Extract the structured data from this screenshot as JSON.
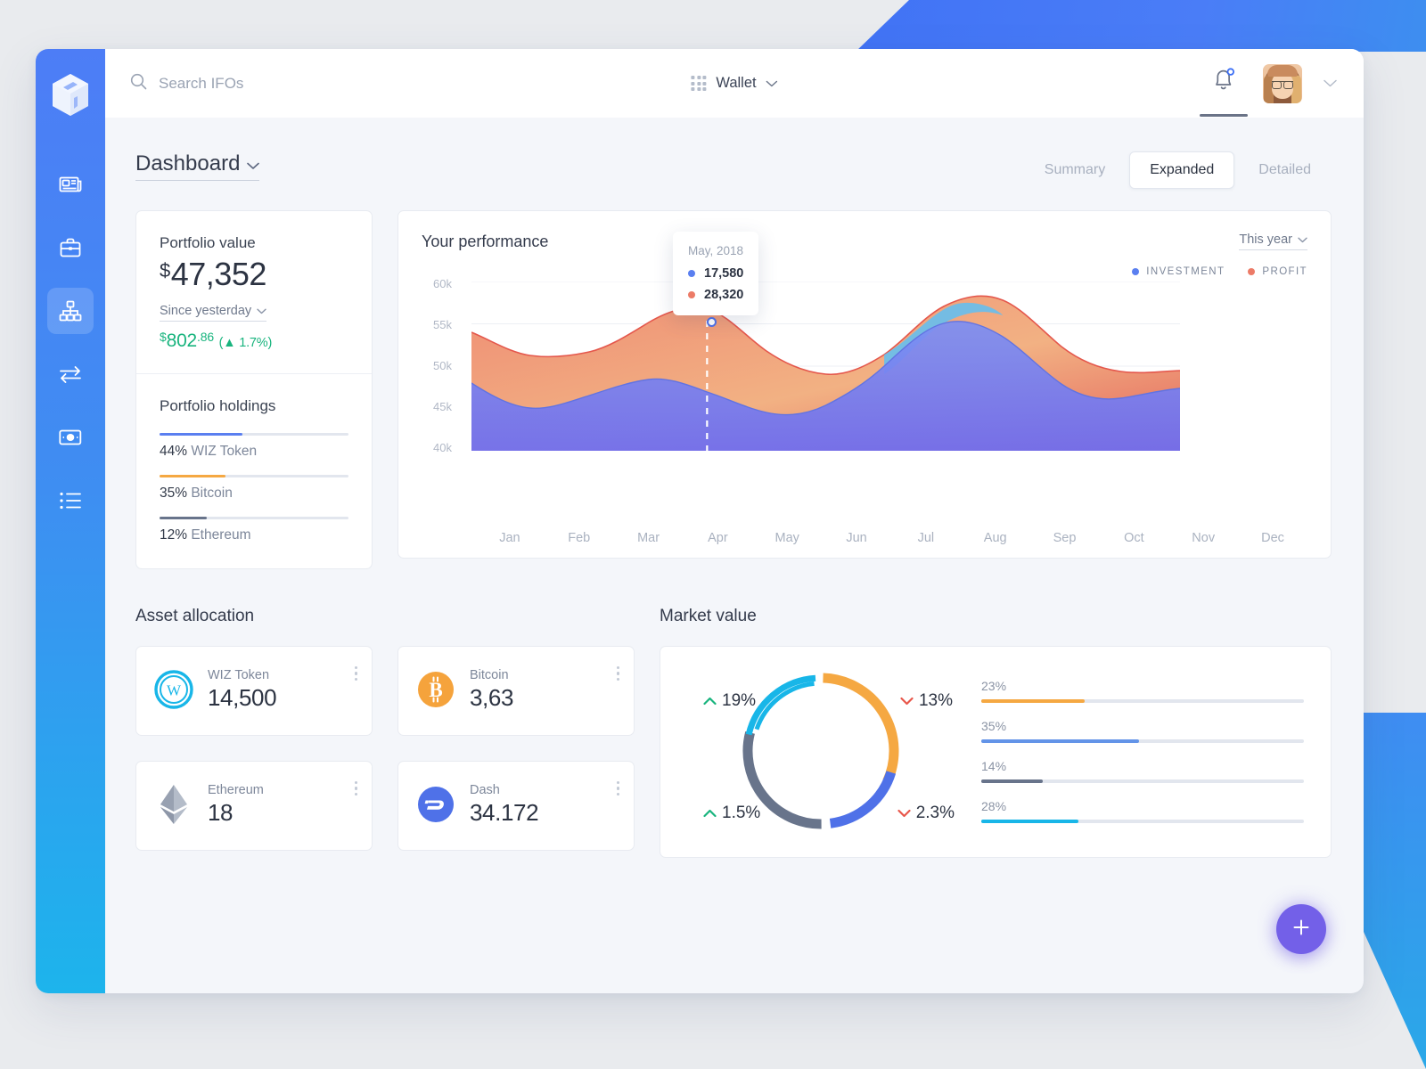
{
  "app": {
    "logo_icon": "cube-logo-icon",
    "accent_blue": "#4d7df6",
    "accent_cyan": "#1db4ec",
    "accent_purple": "#7360e8",
    "green": "#19b47e",
    "red": "#e8564a"
  },
  "sidebar": {
    "items": [
      {
        "name": "news",
        "icon": "newspaper-icon",
        "active": false
      },
      {
        "name": "portfolio",
        "icon": "briefcase-icon",
        "active": false
      },
      {
        "name": "hierarchy",
        "icon": "sitemap-icon",
        "active": true
      },
      {
        "name": "exchange",
        "icon": "exchange-arrows-icon",
        "active": false
      },
      {
        "name": "payments",
        "icon": "banknote-icon",
        "active": false
      },
      {
        "name": "transactions",
        "icon": "list-icon",
        "active": false
      }
    ]
  },
  "topbar": {
    "search_placeholder": "Search IFOs",
    "search_value": "",
    "search_icon": "search-icon",
    "wallet_label": "Wallet",
    "wallet_icon": "grid-apps-icon",
    "notification_icon": "bell-icon",
    "notification_badge": "",
    "avatar_icon": "user-avatar",
    "profile_chevron": "chevron-down-icon"
  },
  "page": {
    "title": "Dashboard",
    "tabs": [
      {
        "label": "Summary",
        "active": false
      },
      {
        "label": "Expanded",
        "active": true
      },
      {
        "label": "Detailed",
        "active": false
      }
    ]
  },
  "portfolio": {
    "value_label": "Portfolio value",
    "currency": "$",
    "value": "47,352",
    "since_label": "Since yesterday",
    "change_currency": "$",
    "change_value": "802",
    "change_cents": ".86",
    "change_paren": "( 1.7%)",
    "change_pct": "1.7%",
    "change_direction": "up",
    "holdings_title": "Portfolio holdings",
    "holdings": [
      {
        "pct": "44%",
        "name": "WIZ Token",
        "value": 44,
        "color": "#5a7ff0"
      },
      {
        "pct": "35%",
        "name": "Bitcoin",
        "value": 35,
        "color": "#f5a842"
      },
      {
        "pct": "12%",
        "name": "Ethereum",
        "value": 12,
        "color": "#68748b"
      }
    ]
  },
  "performance": {
    "title": "Your performance",
    "range_label": "This year",
    "legend": [
      {
        "label": "INVESTMENT",
        "color": "#5a7ff0"
      },
      {
        "label": "PROFIT",
        "color": "#ec7b67"
      }
    ],
    "tooltip": {
      "date": "May, 2018",
      "rows": [
        {
          "value": "17,580",
          "color": "#5a7ff0"
        },
        {
          "value": "28,320",
          "color": "#ec7b67"
        }
      ]
    }
  },
  "chart_data": {
    "type": "area",
    "title": "Your performance",
    "xlabel": "",
    "ylabel": "",
    "grid": true,
    "legend_position": "top-right",
    "categories": [
      "Jan",
      "Feb",
      "Mar",
      "Apr",
      "May",
      "Jun",
      "Jul",
      "Aug",
      "Sep",
      "Oct",
      "Nov",
      "Dec"
    ],
    "ylim": [
      40000,
      60000
    ],
    "yticks": [
      "40k",
      "45k",
      "50k",
      "55k",
      "60k"
    ],
    "series": [
      {
        "name": "INVESTMENT",
        "color": "#5a7ff0",
        "values": [
          48000,
          43900,
          45400,
          48100,
          46400,
          43500,
          47500,
          55300,
          52900,
          45200,
          46900,
          47400
        ]
      },
      {
        "name": "PROFIT",
        "color": "#ec7b67",
        "values": [
          54000,
          51200,
          52600,
          55600,
          54200,
          49400,
          49000,
          54200,
          57800,
          53700,
          49200,
          49400
        ]
      }
    ],
    "highlight": {
      "category": "May",
      "investment": "17,580",
      "profit": "28,320",
      "label": "May, 2018"
    }
  },
  "assets": {
    "section_title": "Asset allocation",
    "cards": [
      {
        "name": "WIZ Token",
        "amount": "14,500",
        "icon": "wiz-token-icon",
        "color": "#18b6e8",
        "menu_icon": "kebab-menu-icon"
      },
      {
        "name": "Bitcoin",
        "amount": "3,63",
        "icon": "bitcoin-icon",
        "color": "#f5a33c",
        "menu_icon": "kebab-menu-icon"
      },
      {
        "name": "Ethereum",
        "amount": "18",
        "icon": "ethereum-icon",
        "color": "#8a94a6",
        "menu_icon": "kebab-menu-icon"
      },
      {
        "name": "Dash",
        "amount": "34.172",
        "icon": "dash-icon",
        "color": "#4f71e8",
        "menu_icon": "kebab-menu-icon"
      }
    ]
  },
  "market": {
    "section_title": "Market value",
    "donut": {
      "type": "pie",
      "segments": [
        {
          "label": "23%",
          "value": 23,
          "color": "#f5a842"
        },
        {
          "label": "35%",
          "value": 35,
          "color": "#4f71e8"
        },
        {
          "label": "14%",
          "value": 14,
          "color": "#68748b"
        },
        {
          "label": "28%",
          "value": 28,
          "color": "#18b6e8"
        }
      ],
      "corner_labels": [
        {
          "position": "top-left",
          "text": "19%",
          "direction": "up",
          "color": "#19b47e"
        },
        {
          "position": "top-right",
          "text": "13%",
          "direction": "down",
          "color": "#e8564a"
        },
        {
          "position": "bottom-left",
          "text": "1.5%",
          "direction": "up",
          "color": "#19b47e"
        },
        {
          "position": "bottom-right",
          "text": "2.3%",
          "direction": "down",
          "color": "#e8564a"
        }
      ]
    },
    "bars": [
      {
        "label": "23%",
        "value": 23,
        "color": "#f5a842"
      },
      {
        "label": "35%",
        "value": 35,
        "color": "#6394e8"
      },
      {
        "label": "14%",
        "value": 14,
        "color": "#68748b"
      },
      {
        "label": "28%",
        "value": 28,
        "color": "#18b6e8"
      }
    ]
  },
  "fab": {
    "icon": "plus-icon",
    "label": "+"
  }
}
